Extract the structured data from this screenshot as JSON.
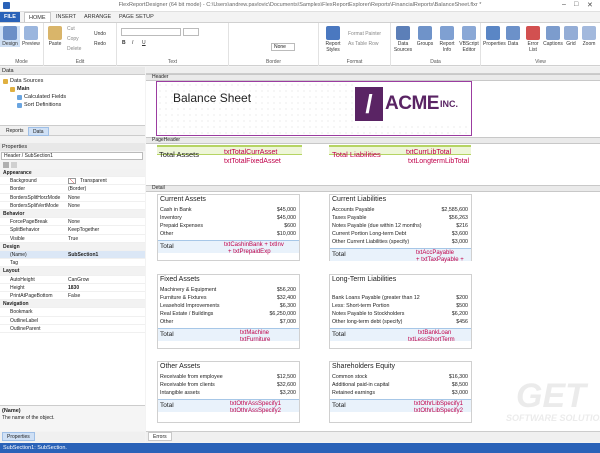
{
  "window": {
    "title": "FlexReportDesigner (64 bit mode) - C:\\Users\\andrew.pavlovic\\Documents\\Samples\\FlexReportExplorer\\Reports\\FinancialReports\\BalanceSheet.flxr *"
  },
  "tabs": [
    "FILE",
    "HOME",
    "INSERT",
    "ARRANGE",
    "PAGE SETUP"
  ],
  "ribbon": {
    "groups": [
      "Mode",
      "Edit",
      "Text",
      "Border",
      "Format",
      "Data",
      "View"
    ],
    "mode": [
      "Design",
      "Preview"
    ],
    "edit": [
      "Paste",
      "Cut",
      "Copy",
      "Delete",
      "Undo",
      "Redo"
    ],
    "text_btns": [
      "B",
      "I",
      "U"
    ],
    "font_size": "None",
    "format_btns": [
      "Format Painter",
      "As Table Row"
    ],
    "styles": "Report Styles",
    "data_btns": [
      "Data Sources",
      "Groups",
      "Report Info",
      "VBScript Editor"
    ],
    "view_btns": [
      "Properties",
      "Data",
      "Error List",
      "Captions",
      "Grid",
      "Zoom"
    ]
  },
  "data_panel": {
    "title": "Data",
    "root": "Data Sources",
    "main": "Main",
    "items": [
      "Calculated Fields",
      "Sort Definitions"
    ],
    "tabs": [
      "Reports",
      "Data"
    ]
  },
  "props_panel": {
    "title": "Properties",
    "combo": "Header / SubSection1",
    "rows": [
      [
        "Appearance",
        ""
      ],
      [
        "Background",
        "Transparent"
      ],
      [
        "Border",
        "(Border)"
      ],
      [
        "BordersSplitHorzMode",
        "None"
      ],
      [
        "BordersSplitVertMode",
        "None"
      ],
      [
        "Behavior",
        ""
      ],
      [
        "ForcePageBreak",
        "None"
      ],
      [
        "SplitBehavior",
        "KeepTogether"
      ],
      [
        "Visible",
        "True"
      ],
      [
        "Design",
        ""
      ],
      [
        "(Name)",
        "SubSection1"
      ],
      [
        "Tag",
        ""
      ],
      [
        "Layout",
        ""
      ],
      [
        "AutoHeight",
        "CanGrow"
      ],
      [
        "Height",
        "1830"
      ],
      [
        "PrintAtPageBottom",
        "False"
      ],
      [
        "Navigation",
        ""
      ],
      [
        "Bookmark",
        ""
      ],
      [
        "OutlineLabel",
        ""
      ],
      [
        "OutlineParent",
        ""
      ]
    ],
    "desc_name": "(Name)",
    "desc_text": "The name of the object.",
    "bottom_tab": "Properties"
  },
  "status": "SubSection1: SubSection.",
  "errors_tab": "Errors",
  "bands": {
    "header": "Header",
    "page_header": "PageHeader",
    "detail": "Detail"
  },
  "report": {
    "title": "Balance Sheet",
    "logo": "ACME",
    "logo_inc": "INC.",
    "ph_left_label": "Total Assets",
    "ph_left_field": "txtTotalCurrAsset",
    "ph_left_field2": "txtTotalFixedAsset",
    "ph_right_label": "Total Liabilities",
    "ph_right_field": "txtCurrLibTotal",
    "ph_right_field2": "txtLongtermLibTotal",
    "sections": [
      {
        "title": "Current Assets",
        "rows": [
          [
            "Cash in Bank",
            "$45,000"
          ],
          [
            "Inventory",
            "$45,000"
          ],
          [
            "Prepaid Expenses",
            "$600"
          ],
          [
            "Other",
            "$10,000"
          ]
        ],
        "total": "Total",
        "f1": "txtCashinBank + txtInv",
        "f2": "+ txtPrepaidExp"
      },
      {
        "title": "Current Liabilities",
        "rows": [
          [
            "Accounts Payable",
            "$2,585,600"
          ],
          [
            "Taxes Payable",
            "$56,263"
          ],
          [
            "Notes Payable (due within 12 months)",
            "$216"
          ],
          [
            "Current Portion Long-term Debt",
            "$3,600"
          ],
          [
            "Other Current Liabilities (specify)",
            "$3,000"
          ]
        ],
        "total": "Total",
        "f1": "txtAccPayable",
        "f2": "+ txtTaxPayable +"
      },
      {
        "title": "Fixed Assets",
        "rows": [
          [
            "Machinery & Equipment",
            "$56,200"
          ],
          [
            "Furniture & Fixtures",
            "$32,400"
          ],
          [
            "Leasehold Improvements",
            "$6,300"
          ],
          [
            "Real Estate / Buildings",
            "$6,250,000"
          ],
          [
            "Other",
            "$7,000"
          ]
        ],
        "total": "Total",
        "f1": "txtMachine",
        "f2": "txtFurniture"
      },
      {
        "title": "Long-Term Liabilities",
        "rows": [
          [
            "Bank Loans Payable (greater than 12",
            "$200"
          ],
          [
            "Less: Short-term Portion",
            "$500"
          ],
          [
            "Notes Payable to Stockholders",
            "$6,200"
          ],
          [
            "Other long-term debt (specify)",
            "$456"
          ]
        ],
        "total": "Total",
        "f1": "txtBankLoan",
        "f2": "txtLessShortTerm"
      },
      {
        "title": "Other Assets",
        "rows": [
          [
            "Receivable from employee",
            "$12,500"
          ],
          [
            "Receivable from clients",
            "$32,600"
          ],
          [
            "Intangible assets",
            "$3,200"
          ]
        ],
        "total": "Total",
        "f1": "txtOthrAssSpecify1",
        "f2": "txtOthrAssSpecify2"
      },
      {
        "title": "Shareholders Equity",
        "rows": [
          [
            "Common stock",
            "$16,300"
          ],
          [
            "Additional paid-in capital",
            "$8,500"
          ],
          [
            "Retained earnings",
            "$3,000"
          ]
        ],
        "total": "Total",
        "f1": "txtOthrLibSpecify1",
        "f2": "txtOthrLibSpecify2"
      }
    ]
  },
  "watermark": {
    "big": "GET",
    "small": "SOFTWARE SOLUTIONS"
  }
}
